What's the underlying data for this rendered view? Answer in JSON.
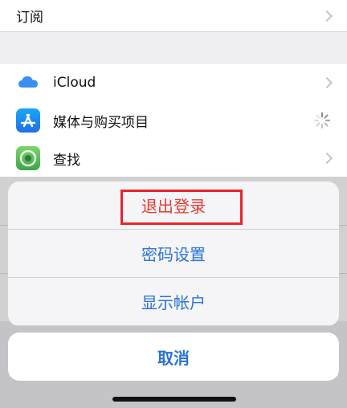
{
  "settings": {
    "subscriptions_label": "订阅",
    "items": [
      {
        "label": "iCloud",
        "icon": "icloud-icon"
      },
      {
        "label": "媒体与购买项目",
        "icon": "app-store-icon"
      },
      {
        "label": "查找",
        "icon": "find-my-icon"
      }
    ]
  },
  "action_sheet": {
    "options": [
      {
        "label": "退出登录"
      },
      {
        "label": "密码设置"
      },
      {
        "label": "显示帐户"
      }
    ],
    "cancel_label": "取消"
  },
  "colors": {
    "accent": "#2a73d6",
    "destructive": "#e63b30",
    "highlight_box": "#e8242b"
  }
}
